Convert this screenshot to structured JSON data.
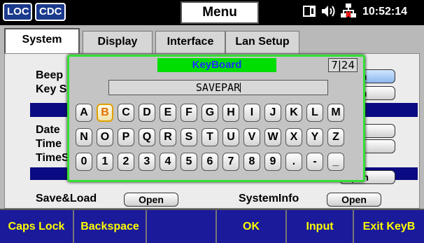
{
  "topbar": {
    "loc": "LOC",
    "cdc": "CDC",
    "menu": "Menu",
    "clock": "10:52:14",
    "icons": [
      "memory-card-icon",
      "speaker-icon",
      "network-disconnected-icon"
    ]
  },
  "tabs": [
    {
      "label": "System",
      "active": true
    },
    {
      "label": "Display",
      "active": false
    },
    {
      "label": "Interface",
      "active": false
    },
    {
      "label": "Lan Setup",
      "active": false
    }
  ],
  "system": {
    "beep": "Beep",
    "key_sound_fragment": "Key S",
    "date": "Date",
    "time": "Time",
    "time_set_fragment": "TimeS",
    "save_load": "Save&Load",
    "system_info": "SystemInfo",
    "open": "Open",
    "open_fragment": "en",
    "open_fragment_n": "n",
    "open_fragment_pen": "pen"
  },
  "keyboard": {
    "title": "KeyBoard",
    "count": "7|24",
    "value": "SAVEPAR",
    "selected_key": "B",
    "rows": [
      [
        "A",
        "B",
        "C",
        "D",
        "E",
        "F",
        "G",
        "H",
        "I",
        "J",
        "K",
        "L",
        "M"
      ],
      [
        "N",
        "O",
        "P",
        "Q",
        "R",
        "S",
        "T",
        "U",
        "V",
        "W",
        "X",
        "Y",
        "Z"
      ],
      [
        "0",
        "1",
        "2",
        "3",
        "4",
        "5",
        "6",
        "7",
        "8",
        "9",
        ".",
        "-",
        "_"
      ]
    ]
  },
  "softkeys": [
    "Caps Lock",
    "Backspace",
    "",
    "OK",
    "Input",
    "Exit KeyB"
  ],
  "colors": {
    "accent_green": "#00dd00",
    "title_blue": "#1a30ff",
    "softkey_bg": "#1b1a9a",
    "softkey_text": "#ffff00",
    "highlight_key": "#e07000"
  }
}
